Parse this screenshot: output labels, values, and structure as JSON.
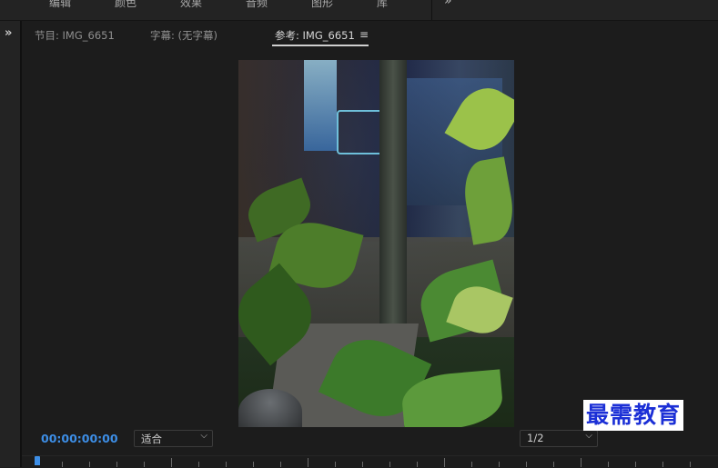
{
  "workspaces": {
    "items": [
      "编辑",
      "颜色",
      "效果",
      "音频",
      "图形",
      "库"
    ],
    "more_symbol": "»"
  },
  "left_strip": {
    "expand_symbol": "»"
  },
  "monitor": {
    "tabs": [
      {
        "label": "节目: IMG_6651"
      },
      {
        "label": "字幕: (无字幕)"
      },
      {
        "label": "参考: IMG_6651"
      }
    ],
    "tab_menu_symbol": "≡",
    "timecode": "00:00:00:00",
    "fit_select": {
      "value": "适合"
    },
    "resolution_select": {
      "value": "1/2"
    }
  },
  "watermark": {
    "text": "最需教育"
  },
  "colors": {
    "accent_blue": "#3d8ee6",
    "watermark_blue": "#1b2fd6",
    "background": "#1d1d1d"
  }
}
